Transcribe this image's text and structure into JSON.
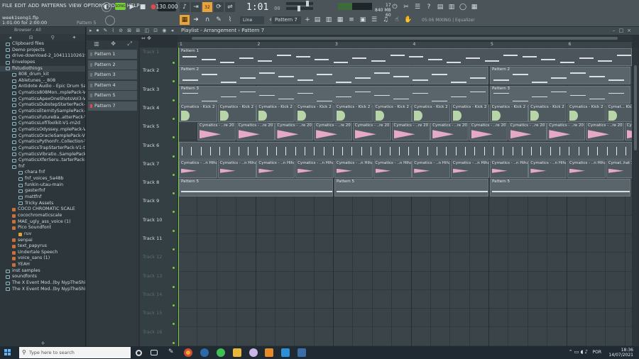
{
  "menu": [
    "FILE",
    "EDIT",
    "ADD",
    "PATTERNS",
    "VIEW",
    "OPTIONS",
    "TOOLS",
    "HELP"
  ],
  "project": {
    "file": "week1song1.flp",
    "time_info": "1:01:00 for 2:00:00",
    "hint_pattern": "Pattern 5"
  },
  "transport": {
    "tempo": "130.000",
    "time": "1:01",
    "time_ticks": "00",
    "mode_label": "PAT",
    "mode_label_alt": "SONG",
    "step_label": "32"
  },
  "snap": "Line",
  "pattern_selector": "Pattern 7",
  "cpu": {
    "value": "17",
    "mem": "840 MB",
    "poly": "60",
    "extra": "0"
  },
  "hint_bar": "05:06   MIXING | Equalizer",
  "browser": {
    "title": "Browser - All",
    "items": [
      {
        "label": "Clipboard files",
        "type": "folder"
      },
      {
        "label": "Demo projects",
        "type": "folder"
      },
      {
        "label": "drive-download-2_1041111026192-001",
        "type": "folder"
      },
      {
        "label": "Envelopes",
        "type": "folder"
      },
      {
        "label": "flstudiothings",
        "type": "folder",
        "selected": true
      },
      {
        "label": "808_drum_kit",
        "type": "folder",
        "indent": 1
      },
      {
        "label": "Abletunes_-_808",
        "type": "folder",
        "indent": 1
      },
      {
        "label": "Antidote Audio - Epic Drum Samples",
        "type": "folder",
        "indent": 1
      },
      {
        "label": "Cymatics808Mon..mplePack-V1-g9m",
        "type": "folder",
        "indent": 1
      },
      {
        "label": "CymaticsApexOneShotsVol3-V1-g5r",
        "type": "folder",
        "indent": 1
      },
      {
        "label": "CymaticsDubstepStarterPack-V1-d4t",
        "type": "folder",
        "indent": 1
      },
      {
        "label": "CymaticsEternitySamplePack-V1-j8i",
        "type": "folder",
        "indent": 1
      },
      {
        "label": "CymaticsFutureBa..atterPack-V1-o3w",
        "type": "folder",
        "indent": 1
      },
      {
        "label": "CymaticsLofiToolkit-V1-m2d",
        "type": "folder",
        "indent": 1
      },
      {
        "label": "CymaticsOdyssey..mplePack-V1-u0m",
        "type": "folder",
        "indent": 1
      },
      {
        "label": "CymaticsOracleSamplePack-V2-c3x",
        "type": "folder",
        "indent": 1
      },
      {
        "label": "CymaticsPythonFr..Collection-V1-p8u",
        "type": "folder",
        "indent": 1
      },
      {
        "label": "CymaticsTrapStarterPack-V1-t5r",
        "type": "folder",
        "indent": 1
      },
      {
        "label": "CymaticsVibratio..SamplePack-V1-h8i",
        "type": "folder",
        "indent": 1
      },
      {
        "label": "CymaticsXferSeru..tarterPack-V1-g7r",
        "type": "folder",
        "indent": 1
      },
      {
        "label": "fnf",
        "type": "folder",
        "indent": 1
      },
      {
        "label": "chara fnf",
        "type": "folder",
        "indent": 2
      },
      {
        "label": "fnf_voices_5a48b",
        "type": "folder",
        "indent": 2
      },
      {
        "label": "funkin-utau-main",
        "type": "folder",
        "indent": 2
      },
      {
        "label": "gasterfnf",
        "type": "folder",
        "indent": 2
      },
      {
        "label": "mattfnf",
        "type": "folder",
        "indent": 2
      },
      {
        "label": "Tricky Assets",
        "type": "folder",
        "indent": 2
      },
      {
        "label": "COCO CHROMATIC SCALE",
        "type": "file",
        "indent": 1
      },
      {
        "label": "cocochromaticscale",
        "type": "file",
        "indent": 1
      },
      {
        "label": "MAE_ugly_ass_voice (1)",
        "type": "file",
        "indent": 1
      },
      {
        "label": "Pico Soundfont",
        "type": "file",
        "indent": 1
      },
      {
        "label": "ruv",
        "type": "file-y",
        "indent": 2
      },
      {
        "label": "senpai",
        "type": "file",
        "indent": 1
      },
      {
        "label": "text_papyrus",
        "type": "file",
        "indent": 1
      },
      {
        "label": "Undertale Speech",
        "type": "file",
        "indent": 1
      },
      {
        "label": "voice_sans (1)",
        "type": "file",
        "indent": 1
      },
      {
        "label": "YEAH",
        "type": "file",
        "indent": 1
      },
      {
        "label": "inst samples",
        "type": "folder"
      },
      {
        "label": "soundfonts",
        "type": "folder"
      },
      {
        "label": "The X Event Mod..(by NypTheShield)",
        "type": "folder"
      },
      {
        "label": "The X Event Mod..(by NypTheShield)",
        "type": "folder"
      }
    ]
  },
  "patterns": [
    "Pattern 1",
    "Pattern 2",
    "Pattern 3",
    "Pattern 4",
    "Pattern 5",
    "Pattern 7"
  ],
  "playlist": {
    "title": "Playlist - Arrangement › Pattern 7",
    "bars": [
      "1",
      "2",
      "3",
      "4",
      "5",
      "6"
    ],
    "tracks": [
      "Track 1",
      "Track 2",
      "Track 3",
      "Track 4",
      "Track 5",
      "Track 6",
      "Track 7",
      "Track 8",
      "Track 9",
      "Track 10",
      "Track 11",
      "Track 12",
      "Track 13",
      "Track 14",
      "Track 15",
      "Track 16"
    ],
    "clip_labels": {
      "p1": "Pattern 1",
      "p2": "Pattern 2",
      "p3": "Pattern 3",
      "p5": "Pattern 5",
      "kick": "Cymatics - Kick 2 - C",
      "kick_last": "Cymat... Kick 2",
      "snare": "Cymatics - ..re 20 - B",
      "hihat": "Cymatics - ..n Hihat 30",
      "hihat_last": "Cymat..hat 30"
    }
  },
  "taskbar": {
    "search_placeholder": "Type here to search",
    "lang": "POR",
    "clock": "18:36",
    "date": "14/07/2021"
  }
}
